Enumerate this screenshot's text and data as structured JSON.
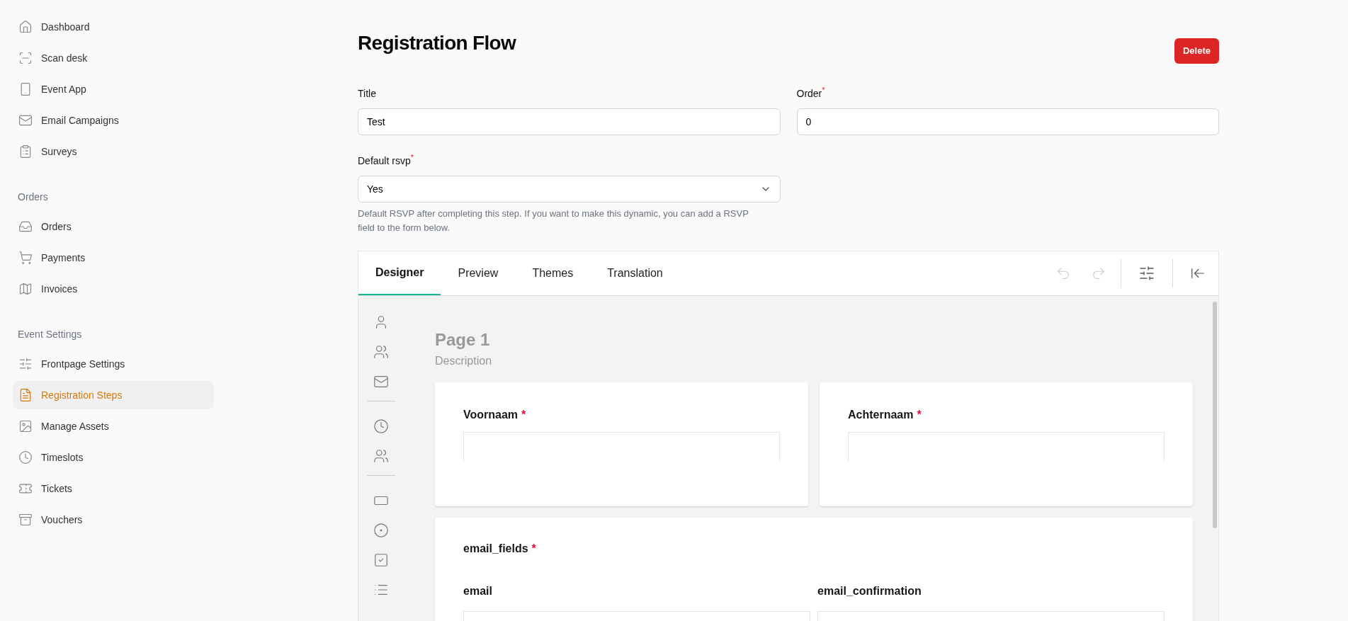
{
  "sidebar": {
    "sections": [
      {
        "items": [
          {
            "label": "Dashboard",
            "selected": false
          },
          {
            "label": "Scan desk",
            "selected": false
          },
          {
            "label": "Event App",
            "selected": false
          },
          {
            "label": "Email Campaigns",
            "selected": false
          },
          {
            "label": "Surveys",
            "selected": false
          }
        ]
      },
      {
        "heading": "Orders",
        "items": [
          {
            "label": "Orders",
            "selected": false
          },
          {
            "label": "Payments",
            "selected": false
          },
          {
            "label": "Invoices",
            "selected": false
          }
        ]
      },
      {
        "heading": "Event Settings",
        "items": [
          {
            "label": "Frontpage Settings",
            "selected": false
          },
          {
            "label": "Registration Steps",
            "selected": true
          },
          {
            "label": "Manage Assets",
            "selected": false
          },
          {
            "label": "Timeslots",
            "selected": false
          },
          {
            "label": "Tickets",
            "selected": false
          },
          {
            "label": "Vouchers",
            "selected": false
          }
        ]
      }
    ]
  },
  "page": {
    "title": "Registration Flow",
    "delete_button": "Delete"
  },
  "form": {
    "title": {
      "label": "Title",
      "value": "Test"
    },
    "order": {
      "label": "Order",
      "required_mark": "*",
      "value": "0"
    },
    "default_rsvp": {
      "label": "Default rsvp",
      "required_mark": "*",
      "value": "Yes",
      "help": "Default RSVP after completing this step. If you want to make this dynamic, you can add a RSVP field to the form below."
    }
  },
  "designer": {
    "tabs": [
      {
        "label": "Designer",
        "selected": true
      },
      {
        "label": "Preview",
        "selected": false
      },
      {
        "label": "Themes",
        "selected": false
      },
      {
        "label": "Translation",
        "selected": false
      }
    ],
    "toolbar": {
      "undo_disabled": true,
      "redo_disabled": true
    },
    "page_title": "Page 1",
    "page_description": "Description",
    "rows": [
      {
        "kind": "pair",
        "questions": [
          {
            "label": "Voornaam",
            "required_mark": "*"
          },
          {
            "label": "Achternaam",
            "required_mark": "*"
          }
        ]
      },
      {
        "kind": "panel",
        "label": "email_fields",
        "required_mark": "*",
        "fields": [
          {
            "label": "email"
          },
          {
            "label": "email_confirmation"
          }
        ]
      }
    ]
  }
}
